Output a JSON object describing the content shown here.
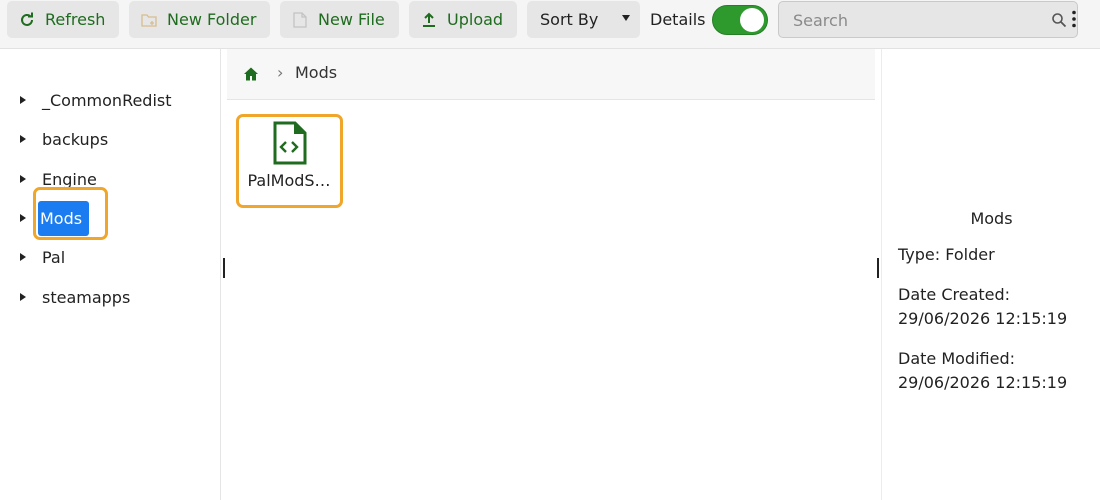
{
  "toolbar": {
    "refresh_label": "Refresh",
    "new_folder_label": "New Folder",
    "new_file_label": "New File",
    "upload_label": "Upload",
    "sort_label": "Sort By",
    "details_label": "Details",
    "details_toggle_on": true,
    "search_placeholder": "Search"
  },
  "tree": {
    "items": [
      {
        "label": "_CommonRedist",
        "selected": false
      },
      {
        "label": "backups",
        "selected": false
      },
      {
        "label": "Engine",
        "selected": false
      },
      {
        "label": "Mods",
        "selected": true
      },
      {
        "label": "Pal",
        "selected": false
      },
      {
        "label": "steamapps",
        "selected": false
      }
    ]
  },
  "breadcrumb": {
    "separator": "›",
    "current": "Mods"
  },
  "files": [
    {
      "name": "PalModS…",
      "icon": "code-file-icon"
    }
  ],
  "details": {
    "name": "Mods",
    "type_line": "Type: Folder",
    "created_label": "Date Created:",
    "created_value": "29/06/2026 12:15:19",
    "modified_label": "Date Modified:",
    "modified_value": "29/06/2026 12:15:19"
  },
  "colors": {
    "accent_green": "#1f6b1f",
    "selection_blue": "#1a7cf0",
    "highlight_orange": "#f0a62a",
    "toggle_green": "#2e9a2e"
  }
}
